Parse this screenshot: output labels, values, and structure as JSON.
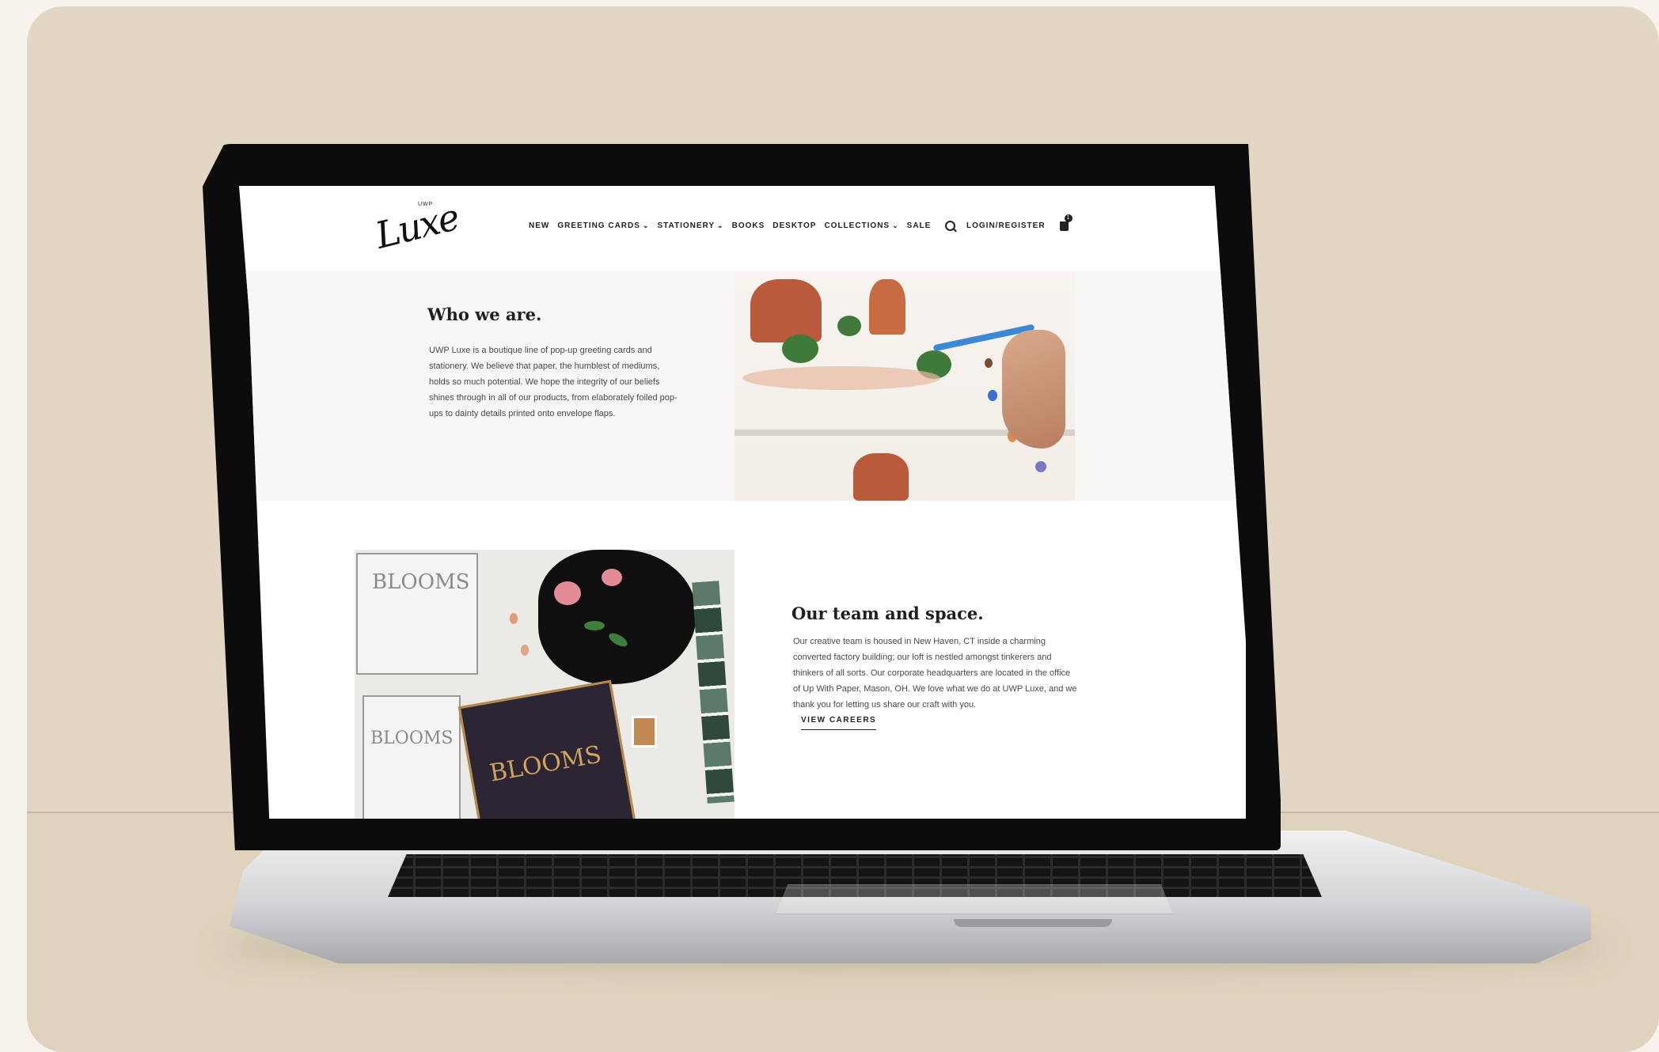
{
  "header": {
    "logo_small": "UWP",
    "logo_script": "Luxe",
    "nav": [
      {
        "label": "NEW",
        "dropdown": false
      },
      {
        "label": "GREETING CARDS",
        "dropdown": true
      },
      {
        "label": "STATIONERY",
        "dropdown": true
      },
      {
        "label": "BOOKS",
        "dropdown": false
      },
      {
        "label": "DESKTOP",
        "dropdown": false
      },
      {
        "label": "COLLECTIONS",
        "dropdown": true
      },
      {
        "label": "SALE",
        "dropdown": false
      }
    ],
    "login_label": "LOGIN/REGISTER",
    "cart_count": "1"
  },
  "who": {
    "title": "Who we are.",
    "body": "UWP Luxe is a boutique line of pop-up greeting cards and stationery. We believe that paper, the humblest of mediums, holds so much potential. We hope the integrity of our beliefs shines through in all of our products, from elaborately foiled pop-ups to dainty details printed onto envelope flaps."
  },
  "team": {
    "title": "Our team and space.",
    "body": "Our creative team is housed in New Haven, CT inside a charming converted factory building; our loft is nestled amongst tinkerers and thinkers of all sorts. Our corporate headquarters are located in the office of Up With Paper, Mason, OH. We love what we do at UWP Luxe, and we thank you for letting us share our craft with you.",
    "cta_label": "VIEW CAREERS"
  },
  "artwork": {
    "sketch_text": "BLOOMS",
    "card_text": "BLOOMS"
  },
  "colors": {
    "backdrop": "#e1d7c4",
    "page_bg": "#f7f2ec",
    "section_bg": "#f8f7f5",
    "text_dark": "#1f1f1f"
  }
}
